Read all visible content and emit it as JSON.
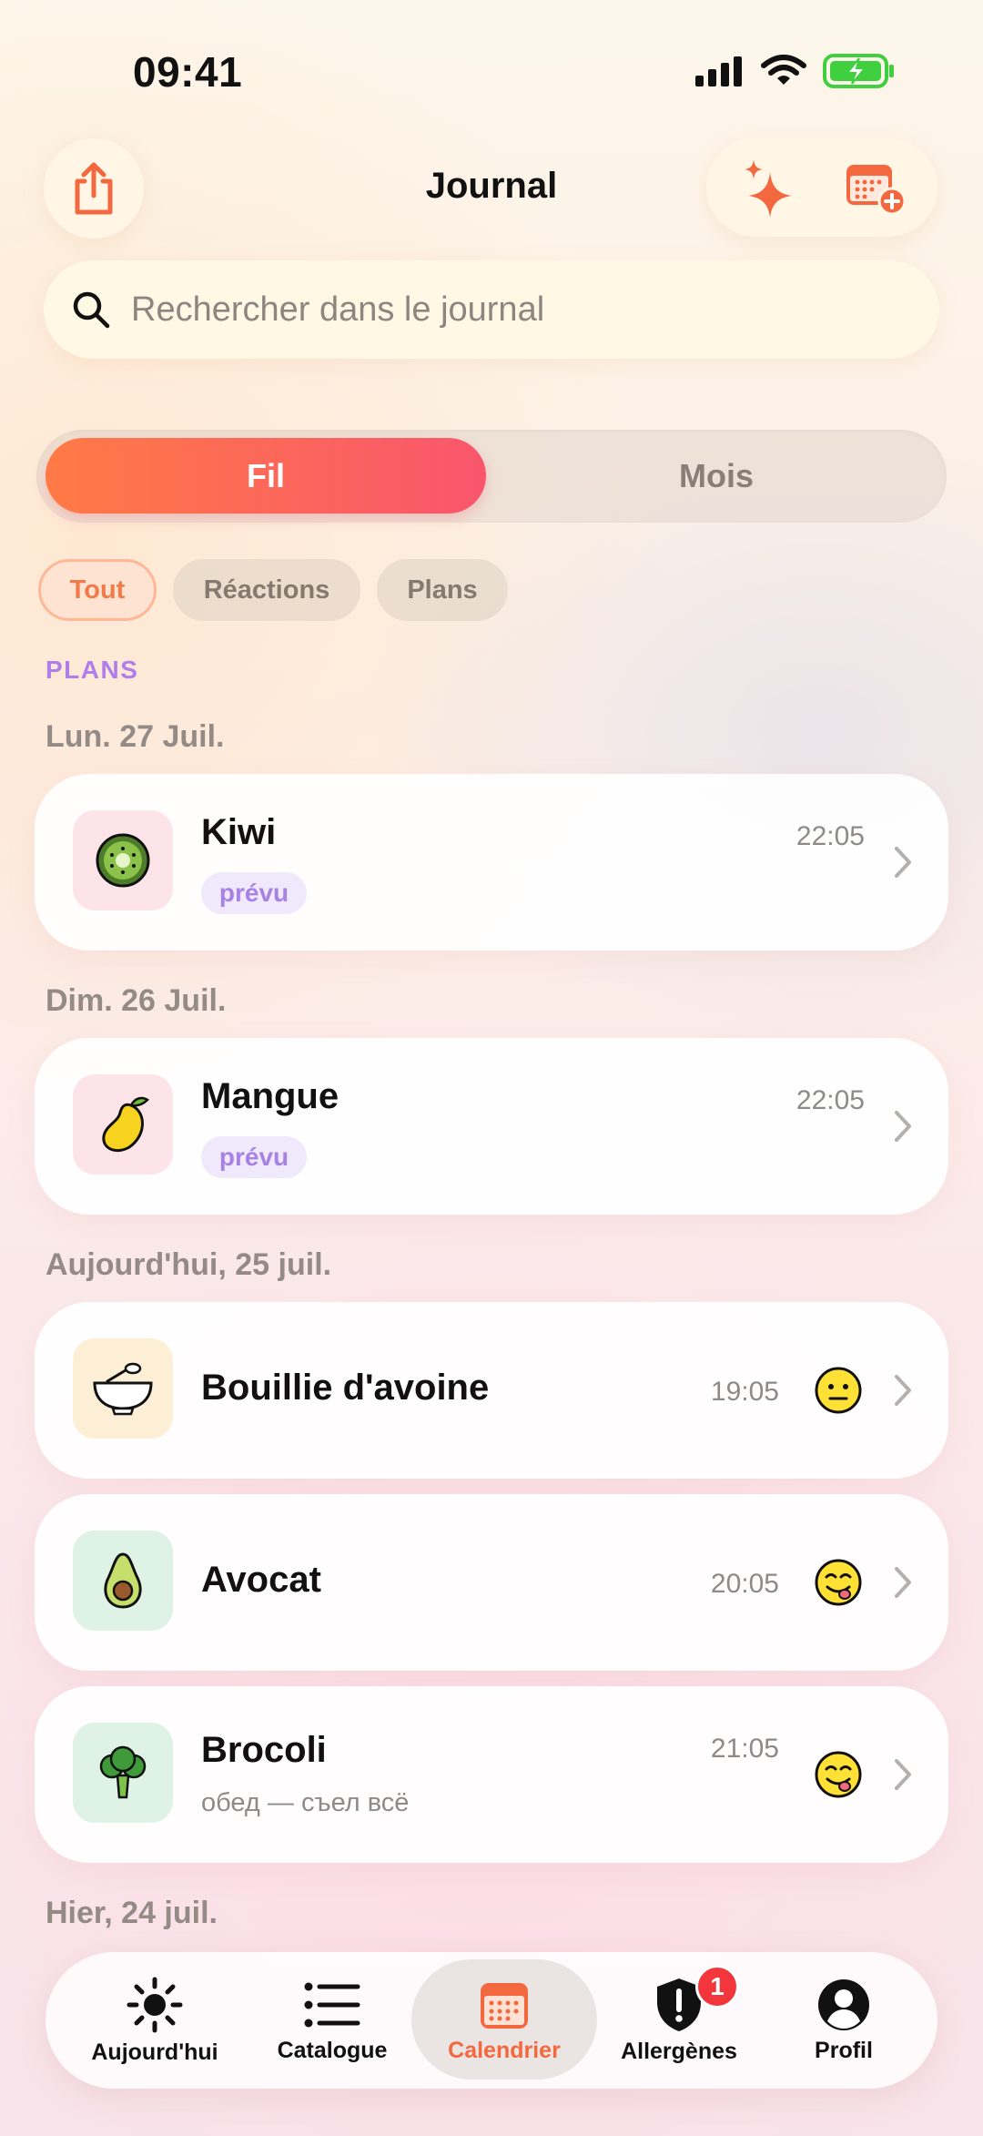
{
  "status_bar": {
    "time": "09:41"
  },
  "header": {
    "title": "Journal"
  },
  "search": {
    "placeholder": "Rechercher dans le journal"
  },
  "segments": {
    "fil": "Fil",
    "mois": "Mois"
  },
  "filters": {
    "all": "Tout",
    "reactions": "Réactions",
    "plans": "Plans"
  },
  "section_label": "PLANS",
  "groups": [
    {
      "date": "Lun. 27 Juil.",
      "items": [
        {
          "name": "Kiwi",
          "time": "22:05",
          "badge": "prévu",
          "icon": "kiwi-icon"
        }
      ]
    },
    {
      "date": "Dim. 26 Juil.",
      "items": [
        {
          "name": "Mangue",
          "time": "22:05",
          "badge": "prévu",
          "icon": "mango-icon"
        }
      ]
    },
    {
      "date": "Aujourd'hui, 25 juil.",
      "items": [
        {
          "name": "Bouillie d'avoine",
          "time": "19:05",
          "icon": "porridge-bowl-icon",
          "reaction": "neutral-face-icon"
        },
        {
          "name": "Avocat",
          "time": "20:05",
          "icon": "avocado-icon",
          "reaction": "yum-face-icon"
        },
        {
          "name": "Brocoli",
          "time": "21:05",
          "note": "обед — съел всё",
          "icon": "broccoli-icon",
          "reaction": "yum-face-icon"
        }
      ]
    },
    {
      "date": "Hier, 24 juil."
    }
  ],
  "tabs": {
    "today": "Aujourd'hui",
    "catalog": "Catalogue",
    "calendar": "Calendrier",
    "allergens": "Allergènes",
    "allergens_badge": "1",
    "profile": "Profil"
  },
  "colors": {
    "accent": "#f4683f",
    "plan_purple": "#b07de9",
    "battery_green": "#3fcf3f"
  }
}
